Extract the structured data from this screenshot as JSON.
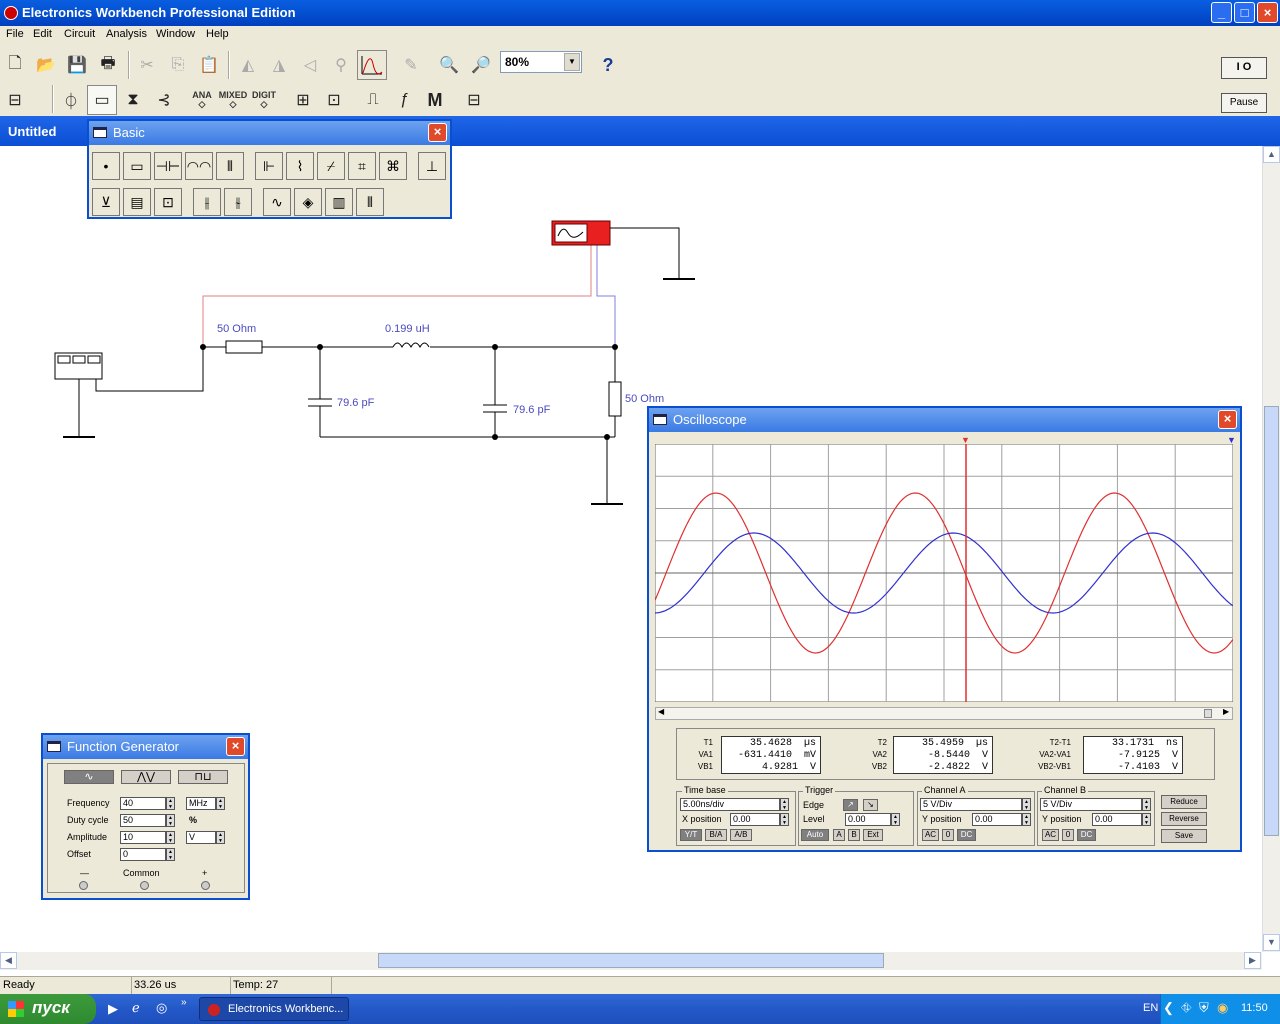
{
  "window": {
    "title": "Electronics Workbench Professional Edition",
    "minimize": "_",
    "maximize": "□",
    "close": "×"
  },
  "menu": [
    "File",
    "Edit",
    "Circuit",
    "Analysis",
    "Window",
    "Help"
  ],
  "toolbar": {
    "zoom": "80%",
    "help": "?",
    "parts_groups": [
      "ANA",
      "MIXED",
      "DIGIT"
    ],
    "meters": "M",
    "power": "I O",
    "pause": "Pause"
  },
  "document": {
    "title": "Untitled"
  },
  "circuit": {
    "r1": "50  Ohm",
    "l1": "0.199 uH",
    "c1": "79.6 pF",
    "c2": "79.6 pF",
    "r2": "50  Ohm"
  },
  "basic_bin": {
    "title": "Basic"
  },
  "func_gen": {
    "title": "Function Generator",
    "fields": [
      {
        "label": "Frequency",
        "value": "40",
        "unit": "MHz"
      },
      {
        "label": "Duty cycle",
        "value": "50",
        "unit": "%"
      },
      {
        "label": "Amplitude",
        "value": "10",
        "unit": "V"
      },
      {
        "label": "Offset",
        "value": "0",
        "unit": ""
      }
    ],
    "terminals": {
      "minus": "—",
      "common": "Common",
      "plus": "+"
    }
  },
  "scope": {
    "title": "Oscilloscope",
    "readouts": {
      "left": {
        "labels": [
          "T1",
          "VA1",
          "VB1"
        ],
        "values": [
          "35.4628  µs",
          "-631.4410  mV",
          "4.9281  V"
        ]
      },
      "mid": {
        "labels": [
          "T2",
          "VA2",
          "VB2"
        ],
        "values": [
          "35.4959  µs",
          "-8.5440  V",
          "-2.4822  V"
        ]
      },
      "right": {
        "labels": [
          "T2-T1",
          "VA2-VA1",
          "VB2-VB1"
        ],
        "values": [
          "33.1731  ns",
          "-7.9125  V",
          "-7.4103  V"
        ]
      }
    },
    "timebase": {
      "label": "Time base",
      "value": "5.00ns/div",
      "xpos_label": "X position",
      "xpos": "0.00",
      "modes": [
        "Y/T",
        "B/A",
        "A/B"
      ]
    },
    "trigger": {
      "label": "Trigger",
      "edge_label": "Edge",
      "level_label": "Level",
      "level": "0.00",
      "modes": [
        "Auto",
        "A",
        "B",
        "Ext"
      ]
    },
    "channel_a": {
      "label": "Channel A",
      "scale": "5 V/Div",
      "ypos_label": "Y position",
      "ypos": "0.00",
      "coupling": [
        "AC",
        "0",
        "DC"
      ]
    },
    "channel_b": {
      "label": "Channel B",
      "scale": "5 V/Div",
      "ypos_label": "Y position",
      "ypos": "0.00",
      "coupling": [
        "AC",
        "0",
        "DC"
      ]
    },
    "buttons": [
      "Reduce",
      "Reverse",
      "Save"
    ],
    "colors": {
      "channel_a": "#e03030",
      "channel_b": "#3030d0",
      "grid": "#a0a0a0"
    }
  },
  "status": {
    "text": "Ready",
    "time": "33.26 us",
    "temp": "Temp:  27"
  },
  "taskbar": {
    "start": "пуск",
    "item": "Electronics Workbenc...",
    "lang": "EN",
    "clock": "11:50"
  }
}
